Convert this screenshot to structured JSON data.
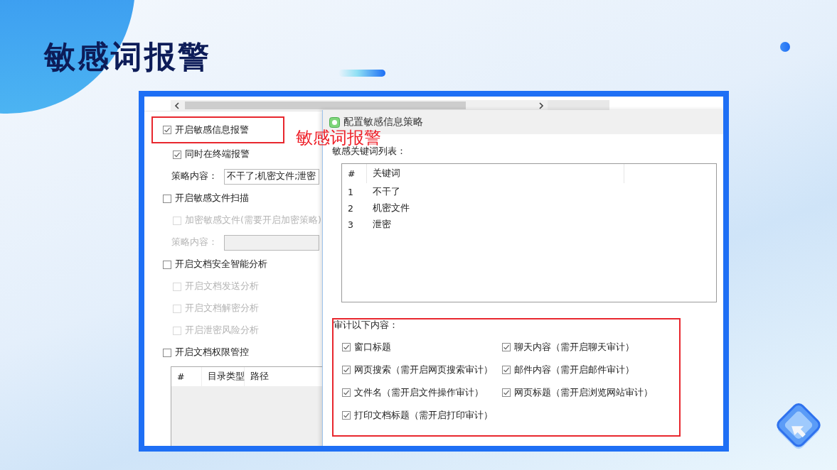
{
  "slide": {
    "title": "敏感词报警"
  },
  "annotation": {
    "text": "敏感词报警"
  },
  "settings": [
    {
      "kind": "checkbox",
      "label": "开启敏感信息报警",
      "checked": true,
      "disabled": false,
      "highlighted": true,
      "children": [
        {
          "kind": "checkbox",
          "label": "同时在终端报警",
          "checked": true,
          "disabled": false
        },
        {
          "kind": "field",
          "label": "策略内容：",
          "value": "不干了;机密文件;泄密",
          "disabled": false
        }
      ]
    },
    {
      "kind": "checkbox",
      "label": "开启敏感文件扫描",
      "checked": false,
      "disabled": false,
      "highlighted": false,
      "children": [
        {
          "kind": "checkbox",
          "label": "加密敏感文件(需要开启加密策略)",
          "checked": false,
          "disabled": true
        },
        {
          "kind": "field",
          "label": "策略内容：",
          "disabled": true
        }
      ]
    },
    {
      "kind": "checkbox",
      "label": "开启文档安全智能分析",
      "checked": false,
      "disabled": false,
      "highlighted": false,
      "children": [
        {
          "kind": "checkbox",
          "label": "开启文档发送分析",
          "checked": false,
          "disabled": true
        },
        {
          "kind": "checkbox",
          "label": "开启文档解密分析",
          "checked": false,
          "disabled": true
        },
        {
          "kind": "checkbox",
          "label": "开启泄密风险分析",
          "checked": false,
          "disabled": true
        }
      ]
    },
    {
      "kind": "checkbox",
      "label": "开启文档权限管控",
      "checked": false,
      "disabled": false,
      "highlighted": false
    }
  ],
  "directory_table": {
    "columns": [
      "#",
      "目录类型",
      "路径"
    ]
  },
  "dialog": {
    "title": "配置敏感信息策略",
    "keyword_list": {
      "label": "敏感关键词列表：",
      "columns": [
        "#",
        "关键词"
      ],
      "rows": [
        {
          "index": "1",
          "keyword": "不干了"
        },
        {
          "index": "2",
          "keyword": "机密文件"
        },
        {
          "index": "3",
          "keyword": "泄密"
        }
      ]
    },
    "audit": {
      "label": "审计以下内容：",
      "highlighted": true,
      "options": [
        {
          "label": "窗口标题",
          "checked": true
        },
        {
          "label": "聊天内容（需开启聊天审计）",
          "checked": true
        },
        {
          "label": "网页搜索（需开启网页搜索审计）",
          "checked": true
        },
        {
          "label": "邮件内容（需开启邮件审计）",
          "checked": true
        },
        {
          "label": "文件名（需开启文件操作审计）",
          "checked": true
        },
        {
          "label": "网页标题（需开启浏览网站审计）",
          "checked": true
        },
        {
          "label": "打印文档标题（需开启打印审计）",
          "checked": true
        }
      ]
    }
  }
}
